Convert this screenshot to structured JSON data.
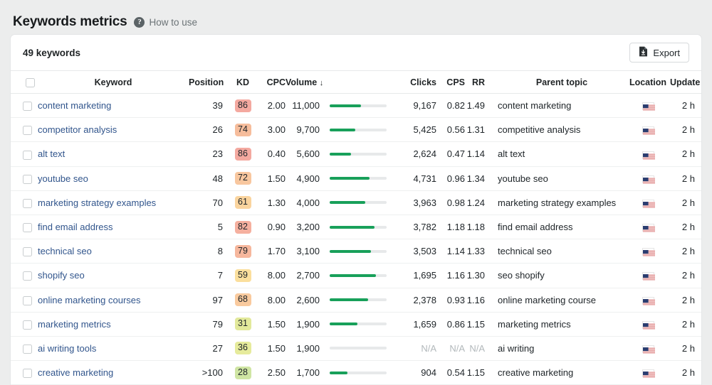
{
  "page": {
    "title": "Keywords metrics",
    "help_link": "How to use",
    "help_icon": "question-mark-circle-icon",
    "background": "#eceded"
  },
  "toolbar": {
    "keyword_count": "49 keywords",
    "export_label": "Export",
    "export_icon": "document-download-icon"
  },
  "table": {
    "columns": [
      {
        "key": "check",
        "label": ""
      },
      {
        "key": "kw",
        "label": "Keyword"
      },
      {
        "key": "pos",
        "label": "Position"
      },
      {
        "key": "kd",
        "label": "KD"
      },
      {
        "key": "cpc",
        "label": "CPC"
      },
      {
        "key": "vol",
        "label": "Volume",
        "sorted": true,
        "sort_arrow": "↓"
      },
      {
        "key": "bar",
        "label": ""
      },
      {
        "key": "clicks",
        "label": "Clicks"
      },
      {
        "key": "cps",
        "label": "CPS"
      },
      {
        "key": "rr",
        "label": "RR"
      },
      {
        "key": "parent",
        "label": "Parent topic"
      },
      {
        "key": "loc",
        "label": "Location"
      },
      {
        "key": "upd",
        "label": "Update"
      }
    ],
    "rows": [
      {
        "keyword": "content marketing",
        "position": "39",
        "kd": "86",
        "kd_color": "#f4a9a0",
        "cpc": "2.00",
        "volume": "11,000",
        "bar_pct": 55,
        "clicks": "9,167",
        "cps": "0.82",
        "rr": "1.49",
        "parent_topic": "content marketing",
        "location": "US",
        "update": "2 h"
      },
      {
        "keyword": "competitor analysis",
        "position": "26",
        "kd": "74",
        "kd_color": "#f6bd9c",
        "cpc": "3.00",
        "volume": "9,700",
        "bar_pct": 45,
        "clicks": "5,425",
        "cps": "0.56",
        "rr": "1.31",
        "parent_topic": "competitive analysis",
        "location": "US",
        "update": "2 h"
      },
      {
        "keyword": "alt text",
        "position": "23",
        "kd": "86",
        "kd_color": "#f4a9a0",
        "cpc": "0.40",
        "volume": "5,600",
        "bar_pct": 37,
        "clicks": "2,624",
        "cps": "0.47",
        "rr": "1.14",
        "parent_topic": "alt text",
        "location": "US",
        "update": "2 h"
      },
      {
        "keyword": "youtube seo",
        "position": "48",
        "kd": "72",
        "kd_color": "#f8c79f",
        "cpc": "1.50",
        "volume": "4,900",
        "bar_pct": 70,
        "clicks": "4,731",
        "cps": "0.96",
        "rr": "1.34",
        "parent_topic": "youtube seo",
        "location": "US",
        "update": "2 h"
      },
      {
        "keyword": "marketing strategy examples",
        "position": "70",
        "kd": "61",
        "kd_color": "#fad49e",
        "cpc": "1.30",
        "volume": "4,000",
        "bar_pct": 62,
        "clicks": "3,963",
        "cps": "0.98",
        "rr": "1.24",
        "parent_topic": "marketing strategy examples",
        "location": "US",
        "update": "2 h"
      },
      {
        "keyword": "find email address",
        "position": "5",
        "kd": "82",
        "kd_color": "#f5b09f",
        "cpc": "0.90",
        "volume": "3,200",
        "bar_pct": 79,
        "clicks": "3,782",
        "cps": "1.18",
        "rr": "1.18",
        "parent_topic": "find email address",
        "location": "US",
        "update": "2 h"
      },
      {
        "keyword": "technical seo",
        "position": "8",
        "kd": "79",
        "kd_color": "#f6b79d",
        "cpc": "1.70",
        "volume": "3,100",
        "bar_pct": 72,
        "clicks": "3,503",
        "cps": "1.14",
        "rr": "1.33",
        "parent_topic": "technical seo",
        "location": "US",
        "update": "2 h"
      },
      {
        "keyword": "shopify seo",
        "position": "7",
        "kd": "59",
        "kd_color": "#fbdf9d",
        "cpc": "8.00",
        "volume": "2,700",
        "bar_pct": 81,
        "clicks": "1,695",
        "cps": "1.16",
        "rr": "1.30",
        "parent_topic": "seo shopify",
        "location": "US",
        "update": "2 h"
      },
      {
        "keyword": "online marketing courses",
        "position": "97",
        "kd": "68",
        "kd_color": "#f9ca9e",
        "cpc": "8.00",
        "volume": "2,600",
        "bar_pct": 67,
        "clicks": "2,378",
        "cps": "0.93",
        "rr": "1.16",
        "parent_topic": "online marketing course",
        "location": "US",
        "update": "2 h"
      },
      {
        "keyword": "marketing metrics",
        "position": "79",
        "kd": "31",
        "kd_color": "#e2e99b",
        "cpc": "1.50",
        "volume": "1,900",
        "bar_pct": 49,
        "clicks": "1,659",
        "cps": "0.86",
        "rr": "1.15",
        "parent_topic": "marketing metrics",
        "location": "US",
        "update": "2 h"
      },
      {
        "keyword": "ai writing tools",
        "position": "27",
        "kd": "36",
        "kd_color": "#e6eb9c",
        "cpc": "1.50",
        "volume": "1,900",
        "bar_pct": 0,
        "clicks": "N/A",
        "cps": "N/A",
        "rr": "N/A",
        "parent_topic": "ai writing",
        "location": "US",
        "update": "2 h"
      },
      {
        "keyword": "creative marketing",
        "position": ">100",
        "kd": "28",
        "kd_color": "#cfe5a3",
        "cpc": "2.50",
        "volume": "1,700",
        "bar_pct": 31,
        "clicks": "904",
        "cps": "0.54",
        "rr": "1.15",
        "parent_topic": "creative marketing",
        "location": "US",
        "update": "2 h"
      }
    ]
  },
  "colors": {
    "link": "#31558c",
    "bar_fill": "#18a05a",
    "bar_track": "#e7e9ea",
    "na_text": "#b2b8bb"
  }
}
